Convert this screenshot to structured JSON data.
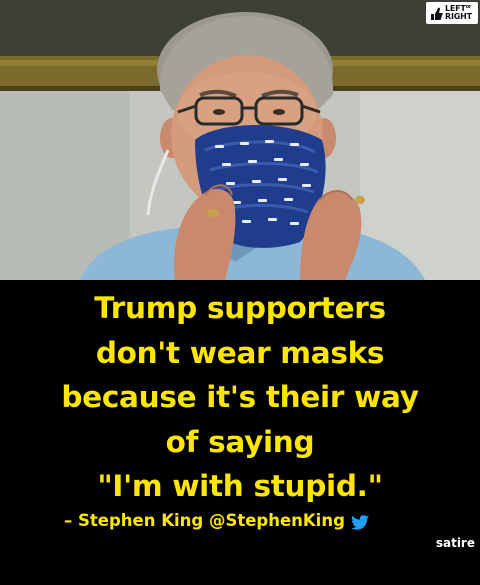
{
  "photo": {
    "subject": "stephen-king-mask-photo"
  },
  "logo": {
    "line1_word": "LEFT",
    "line1_small": "or",
    "line2": "RIGHT",
    "icon": "thumb-icon"
  },
  "quote": {
    "lines": [
      "Trump supporters",
      "don't wear masks",
      "because it's their way",
      "of saying",
      "\"I'm with stupid.\""
    ]
  },
  "attribution": {
    "text": "– Stephen King @StephenKing",
    "icon": "twitter-bird-icon"
  },
  "tag": {
    "text": "satire"
  },
  "colors": {
    "caption_background": "#000000",
    "caption_text": "#ffe600",
    "twitter_blue": "#1da1f2",
    "tag_text": "#ffffff"
  }
}
